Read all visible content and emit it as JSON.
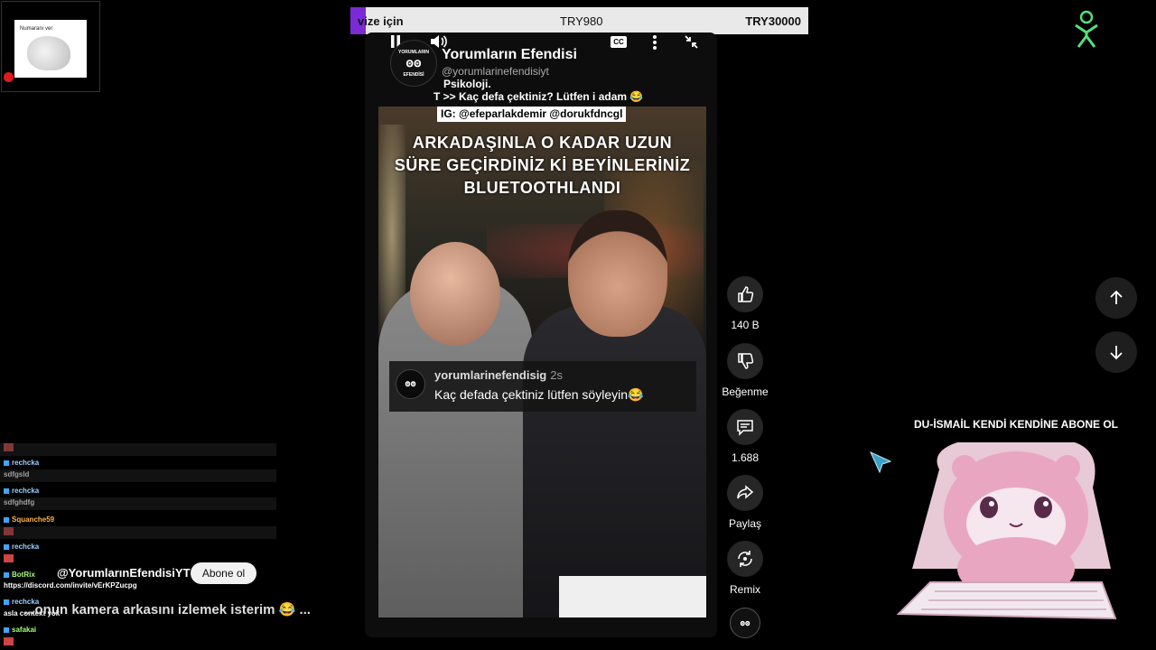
{
  "banner": {
    "left": "vize için",
    "mid": "TRY980",
    "right": "TRY30000"
  },
  "webcam": {
    "label": "Numaranı ver"
  },
  "player": {
    "channel_name": "Yorumların Efendisi",
    "channel_handle": "@yorumlarinefendisiyt",
    "avatar_top": "YORUMLARIN",
    "avatar_eyes": "ꙩꙩ",
    "avatar_bottom": "EFENDİSİ",
    "desc_line1": "Psikoloji.",
    "desc_line2": "T >> Kaç defa çektiniz? Lütfen i adam 😂",
    "desc_line3": "IG: @efeparlakdemir @dorukfdncgl",
    "cc_label": "CC",
    "caption": [
      "ARKADAŞINLA O KADAR UZUN",
      "SÜRE GEÇİRDİNİZ Kİ BEYİNLERİNİZ",
      "BLUETOOTHLANDI"
    ],
    "comment": {
      "user": "yorumlarinefendisig",
      "time": "2s",
      "text": "Kaç defada çektiniz lütfen söyleyin😂",
      "avatar": "ꙩꙩ"
    }
  },
  "actions": {
    "like_label": "140 B",
    "dislike_label": "Beğenme",
    "comments_label": "1.688",
    "share_label": "Paylaş",
    "remix_label": "Remix"
  },
  "overlay": {
    "subscribe_text": "DU-İSMAİL KENDİ KENDİNE ABONE OL"
  },
  "chat": {
    "lines": [
      {
        "user": "rechcka",
        "msg": "sdfgsld"
      },
      {
        "user": "rechcka",
        "msg": "sdfghdfg"
      },
      {
        "user": "Squanche59",
        "msg": ""
      },
      {
        "user": "rechcka",
        "msg": ""
      },
      {
        "user": "BotRix",
        "msg": "https://discord.com/invite/vErKPZucpg"
      },
      {
        "user": "rechcka",
        "msg": "asla context yok"
      },
      {
        "user": "safakai",
        "msg": ""
      }
    ],
    "yt_handle": "@YorumlarınEfendisiYT",
    "subscribe_button": "Abone ol",
    "big_comment": "...onun kamera arkasını izlemek isterim 😂  ..."
  },
  "colors": {
    "banner_stripe": "#7a2bd6",
    "chat_name": "#9ed0ff",
    "accent_green": "#55e07a"
  }
}
